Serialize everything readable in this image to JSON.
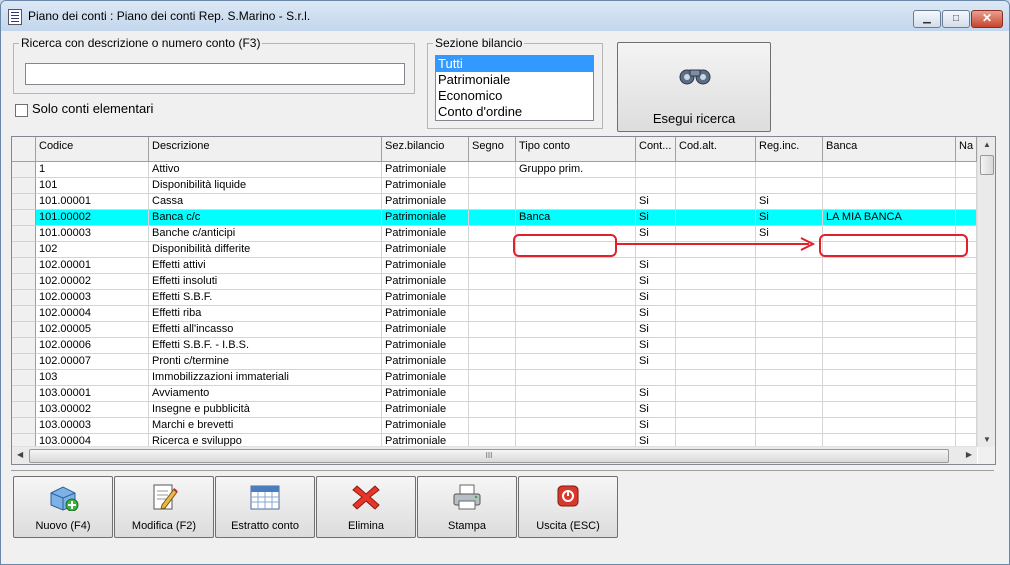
{
  "window": {
    "title": "Piano dei conti : Piano dei conti Rep. S.Marino - S.r.l.",
    "buttons": {
      "minimize": "▁",
      "maximize": "□",
      "close": "✕"
    }
  },
  "search": {
    "legend": "Ricerca con descrizione o numero conto (F3)",
    "value": "",
    "checkbox_label": "Solo conti elementari"
  },
  "section": {
    "legend": "Sezione bilancio",
    "options": [
      "Tutti",
      "Patrimoniale",
      "Economico",
      "Conto d'ordine"
    ],
    "selected": "Tutti"
  },
  "run_search_label": "Esegui ricerca",
  "grid": {
    "columns": [
      "Codice",
      "Descrizione",
      "Sez.bilancio",
      "Segno",
      "Tipo conto",
      "Cont...",
      "Cod.alt.",
      "Reg.inc.",
      "Banca",
      "Na"
    ],
    "rows": [
      {
        "codice": "1",
        "descrizione": "Attivo",
        "sez": "Patrimoniale",
        "segno": "",
        "tipo": "Gruppo prim.",
        "cont": "",
        "codalt": "",
        "reginc": "",
        "banca": ""
      },
      {
        "codice": "101",
        "descrizione": "Disponibilità liquide",
        "sez": "Patrimoniale",
        "segno": "",
        "tipo": "",
        "cont": "",
        "codalt": "",
        "reginc": "",
        "banca": ""
      },
      {
        "codice": "101.00001",
        "descrizione": "Cassa",
        "sez": "Patrimoniale",
        "segno": "",
        "tipo": "",
        "cont": "Si",
        "codalt": "",
        "reginc": "Si",
        "banca": ""
      },
      {
        "codice": "101.00002",
        "descrizione": "Banca c/c",
        "sez": "Patrimoniale",
        "segno": "",
        "tipo": "Banca",
        "cont": "Si",
        "codalt": "",
        "reginc": "Si",
        "banca": "LA MIA BANCA"
      },
      {
        "codice": "101.00003",
        "descrizione": "Banche c/anticipi",
        "sez": "Patrimoniale",
        "segno": "",
        "tipo": "",
        "cont": "Si",
        "codalt": "",
        "reginc": "Si",
        "banca": ""
      },
      {
        "codice": "102",
        "descrizione": "Disponibilità differite",
        "sez": "Patrimoniale",
        "segno": "",
        "tipo": "",
        "cont": "",
        "codalt": "",
        "reginc": "",
        "banca": ""
      },
      {
        "codice": "102.00001",
        "descrizione": "Effetti attivi",
        "sez": "Patrimoniale",
        "segno": "",
        "tipo": "",
        "cont": "Si",
        "codalt": "",
        "reginc": "",
        "banca": ""
      },
      {
        "codice": "102.00002",
        "descrizione": "Effetti insoluti",
        "sez": "Patrimoniale",
        "segno": "",
        "tipo": "",
        "cont": "Si",
        "codalt": "",
        "reginc": "",
        "banca": ""
      },
      {
        "codice": "102.00003",
        "descrizione": "Effetti S.B.F.",
        "sez": "Patrimoniale",
        "segno": "",
        "tipo": "",
        "cont": "Si",
        "codalt": "",
        "reginc": "",
        "banca": ""
      },
      {
        "codice": "102.00004",
        "descrizione": "Effetti riba",
        "sez": "Patrimoniale",
        "segno": "",
        "tipo": "",
        "cont": "Si",
        "codalt": "",
        "reginc": "",
        "banca": ""
      },
      {
        "codice": "102.00005",
        "descrizione": "Effetti all'incasso",
        "sez": "Patrimoniale",
        "segno": "",
        "tipo": "",
        "cont": "Si",
        "codalt": "",
        "reginc": "",
        "banca": ""
      },
      {
        "codice": "102.00006",
        "descrizione": "Effetti S.B.F. - I.B.S.",
        "sez": "Patrimoniale",
        "segno": "",
        "tipo": "",
        "cont": "Si",
        "codalt": "",
        "reginc": "",
        "banca": ""
      },
      {
        "codice": "102.00007",
        "descrizione": "Pronti c/termine",
        "sez": "Patrimoniale",
        "segno": "",
        "tipo": "",
        "cont": "Si",
        "codalt": "",
        "reginc": "",
        "banca": ""
      },
      {
        "codice": "103",
        "descrizione": "Immobilizzazioni immateriali",
        "sez": "Patrimoniale",
        "segno": "",
        "tipo": "",
        "cont": "",
        "codalt": "",
        "reginc": "",
        "banca": ""
      },
      {
        "codice": "103.00001",
        "descrizione": "Avviamento",
        "sez": "Patrimoniale",
        "segno": "",
        "tipo": "",
        "cont": "Si",
        "codalt": "",
        "reginc": "",
        "banca": ""
      },
      {
        "codice": "103.00002",
        "descrizione": "Insegne e pubblicità",
        "sez": "Patrimoniale",
        "segno": "",
        "tipo": "",
        "cont": "Si",
        "codalt": "",
        "reginc": "",
        "banca": ""
      },
      {
        "codice": "103.00003",
        "descrizione": "Marchi e brevetti",
        "sez": "Patrimoniale",
        "segno": "",
        "tipo": "",
        "cont": "Si",
        "codalt": "",
        "reginc": "",
        "banca": ""
      },
      {
        "codice": "103.00004",
        "descrizione": "Ricerca e sviluppo",
        "sez": "Patrimoniale",
        "segno": "",
        "tipo": "",
        "cont": "Si",
        "codalt": "",
        "reginc": "",
        "banca": ""
      }
    ],
    "selected_codice": "101.00002",
    "hscroll_label": "III"
  },
  "toolbar": {
    "buttons": [
      {
        "label": "Nuovo (F4)",
        "icon": "new-record-icon"
      },
      {
        "label": "Modifica (F2)",
        "icon": "edit-icon"
      },
      {
        "label": "Estratto conto",
        "icon": "calendar-icon"
      },
      {
        "label": "Elimina",
        "icon": "delete-icon"
      },
      {
        "label": "Stampa",
        "icon": "printer-icon"
      },
      {
        "label": "Uscita (ESC)",
        "icon": "exit-icon"
      }
    ]
  },
  "colors": {
    "selected_row": "#00ffff",
    "highlight": "#e0202a",
    "list_selection": "#3399ff"
  }
}
